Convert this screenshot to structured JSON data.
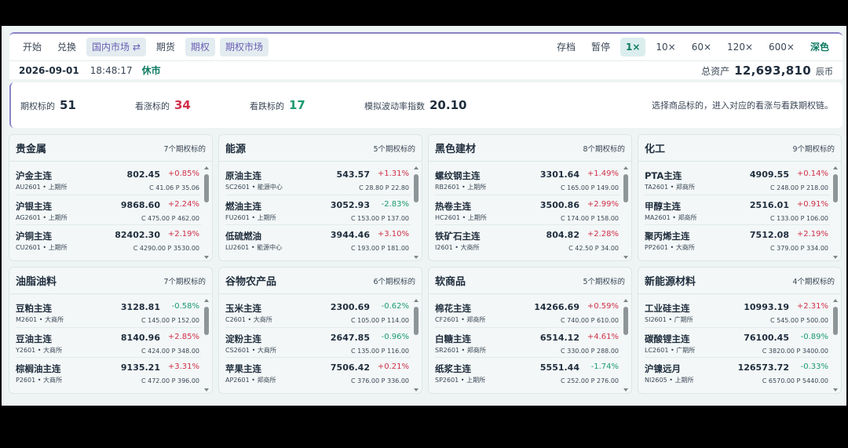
{
  "topbar": {
    "left": [
      {
        "label": "开始",
        "style": "plain"
      },
      {
        "label": "兑换",
        "style": "plain"
      },
      {
        "label": "国内市场 ⇄",
        "style": "purple"
      },
      {
        "label": "期货",
        "style": "plain"
      },
      {
        "label": "期权",
        "style": "purple"
      },
      {
        "label": "期权市场",
        "style": "purple"
      }
    ],
    "right": [
      {
        "label": "存档",
        "style": "plain"
      },
      {
        "label": "暂停",
        "style": "plain"
      },
      {
        "label": "1×",
        "style": "active"
      },
      {
        "label": "10×",
        "style": "speed"
      },
      {
        "label": "60×",
        "style": "speed"
      },
      {
        "label": "120×",
        "style": "speed"
      },
      {
        "label": "600×",
        "style": "speed"
      },
      {
        "label": "深色",
        "style": "teal"
      }
    ]
  },
  "status": {
    "date": "2026-09-01",
    "time": "18:48:17",
    "market_state": "休市",
    "assets_label": "总资产",
    "assets_value": "12,693,810",
    "assets_unit": "辰币"
  },
  "summary": {
    "underlyings_label": "期权标的",
    "underlyings_value": "51",
    "bullish_label": "看涨标的",
    "bullish_value": "34",
    "bearish_label": "看跌标的",
    "bearish_value": "17",
    "vol_label": "模拟波动率指数",
    "vol_value": "20.10",
    "hint": "选择商品标的，进入对应的看涨与看跌期权链。"
  },
  "colors": {
    "accent": "#8a82c8",
    "up": "#d0304a",
    "down": "#1a9b6f",
    "teal": "#0e7a61"
  },
  "sectors": [
    {
      "title": "贵金属",
      "count": "7个期权标的",
      "items": [
        {
          "name": "沪金主连",
          "code": "AU2601 • 上期所",
          "price": "802.45",
          "chg": "+0.85%",
          "cp": "C 41.06   P 35.06"
        },
        {
          "name": "沪银主连",
          "code": "AG2601 • 上期所",
          "price": "9868.60",
          "chg": "+2.24%",
          "cp": "C 475.00   P 462.00"
        },
        {
          "name": "沪铜主连",
          "code": "CU2601 • 上期所",
          "price": "82402.30",
          "chg": "+2.19%",
          "cp": "C 4290.00   P 3530.00"
        }
      ]
    },
    {
      "title": "能源",
      "count": "5个期权标的",
      "items": [
        {
          "name": "原油主连",
          "code": "SC2601 • 能源中心",
          "price": "543.57",
          "chg": "+1.31%",
          "cp": "C 28.80   P 22.80"
        },
        {
          "name": "燃油主连",
          "code": "FU2601 • 上期所",
          "price": "3052.93",
          "chg": "-2.83%",
          "cp": "C 153.00   P 137.00"
        },
        {
          "name": "低硫燃油",
          "code": "LU2601 • 能源中心",
          "price": "3944.46",
          "chg": "+3.10%",
          "cp": "C 193.00   P 181.00"
        }
      ]
    },
    {
      "title": "黑色建材",
      "count": "8个期权标的",
      "items": [
        {
          "name": "螺纹钢主连",
          "code": "RB2601 • 上期所",
          "price": "3301.64",
          "chg": "+1.49%",
          "cp": "C 165.00   P 149.00"
        },
        {
          "name": "热卷主连",
          "code": "HC2601 • 上期所",
          "price": "3500.86",
          "chg": "+2.99%",
          "cp": "C 174.00   P 158.00"
        },
        {
          "name": "铁矿石主连",
          "code": "I2601 • 大商所",
          "price": "804.82",
          "chg": "+2.28%",
          "cp": "C 42.50   P 34.00"
        }
      ]
    },
    {
      "title": "化工",
      "count": "9个期权标的",
      "items": [
        {
          "name": "PTA主连",
          "code": "TA2601 • 郑商所",
          "price": "4909.55",
          "chg": "+0.14%",
          "cp": "C 248.00   P 218.00"
        },
        {
          "name": "甲醇主连",
          "code": "MA2601 • 郑商所",
          "price": "2516.01",
          "chg": "+0.91%",
          "cp": "C 133.00   P 106.00"
        },
        {
          "name": "聚丙烯主连",
          "code": "PP2601 • 大商所",
          "price": "7512.08",
          "chg": "+2.19%",
          "cp": "C 379.00   P 334.00"
        }
      ]
    },
    {
      "title": "油脂油料",
      "count": "7个期权标的",
      "items": [
        {
          "name": "豆粕主连",
          "code": "M2601 • 大商所",
          "price": "3128.81",
          "chg": "-0.58%",
          "cp": "C 145.00   P 152.00"
        },
        {
          "name": "豆油主连",
          "code": "Y2601 • 大商所",
          "price": "8140.96",
          "chg": "+2.85%",
          "cp": "C 424.00   P 348.00"
        },
        {
          "name": "棕榈油主连",
          "code": "P2601 • 大商所",
          "price": "9135.21",
          "chg": "+3.31%",
          "cp": "C 472.00   P 396.00"
        }
      ]
    },
    {
      "title": "谷物农产品",
      "count": "6个期权标的",
      "items": [
        {
          "name": "玉米主连",
          "code": "C2601 • 大商所",
          "price": "2300.69",
          "chg": "-0.62%",
          "cp": "C 105.00   P 114.00"
        },
        {
          "name": "淀粉主连",
          "code": "CS2601 • 大商所",
          "price": "2647.85",
          "chg": "-0.96%",
          "cp": "C 135.00   P 116.00"
        },
        {
          "name": "苹果主连",
          "code": "AP2601 • 郑商所",
          "price": "7506.42",
          "chg": "+0.21%",
          "cp": "C 376.00   P 336.00"
        }
      ]
    },
    {
      "title": "软商品",
      "count": "5个期权标的",
      "items": [
        {
          "name": "棉花主连",
          "code": "CF2601 • 郑商所",
          "price": "14266.69",
          "chg": "+0.59%",
          "cp": "C 740.00   P 610.00"
        },
        {
          "name": "白糖主连",
          "code": "SR2601 • 郑商所",
          "price": "6514.12",
          "chg": "+4.61%",
          "cp": "C 330.00   P 288.00"
        },
        {
          "name": "纸浆主连",
          "code": "SP2601 • 上期所",
          "price": "5551.44",
          "chg": "-1.74%",
          "cp": "C 252.00   P 276.00"
        }
      ]
    },
    {
      "title": "新能源材料",
      "count": "4个期权标的",
      "items": [
        {
          "name": "工业硅主连",
          "code": "SI2601 • 广期所",
          "price": "10993.19",
          "chg": "+2.31%",
          "cp": "C 545.00   P 500.00"
        },
        {
          "name": "碳酸锂主连",
          "code": "LC2601 • 广期所",
          "price": "76100.45",
          "chg": "-0.89%",
          "cp": "C 3820.00   P 3400.00"
        },
        {
          "name": "沪镍远月",
          "code": "NI2605 • 上期所",
          "price": "126573.72",
          "chg": "-0.33%",
          "cp": "C 6570.00   P 5440.00"
        }
      ]
    }
  ]
}
